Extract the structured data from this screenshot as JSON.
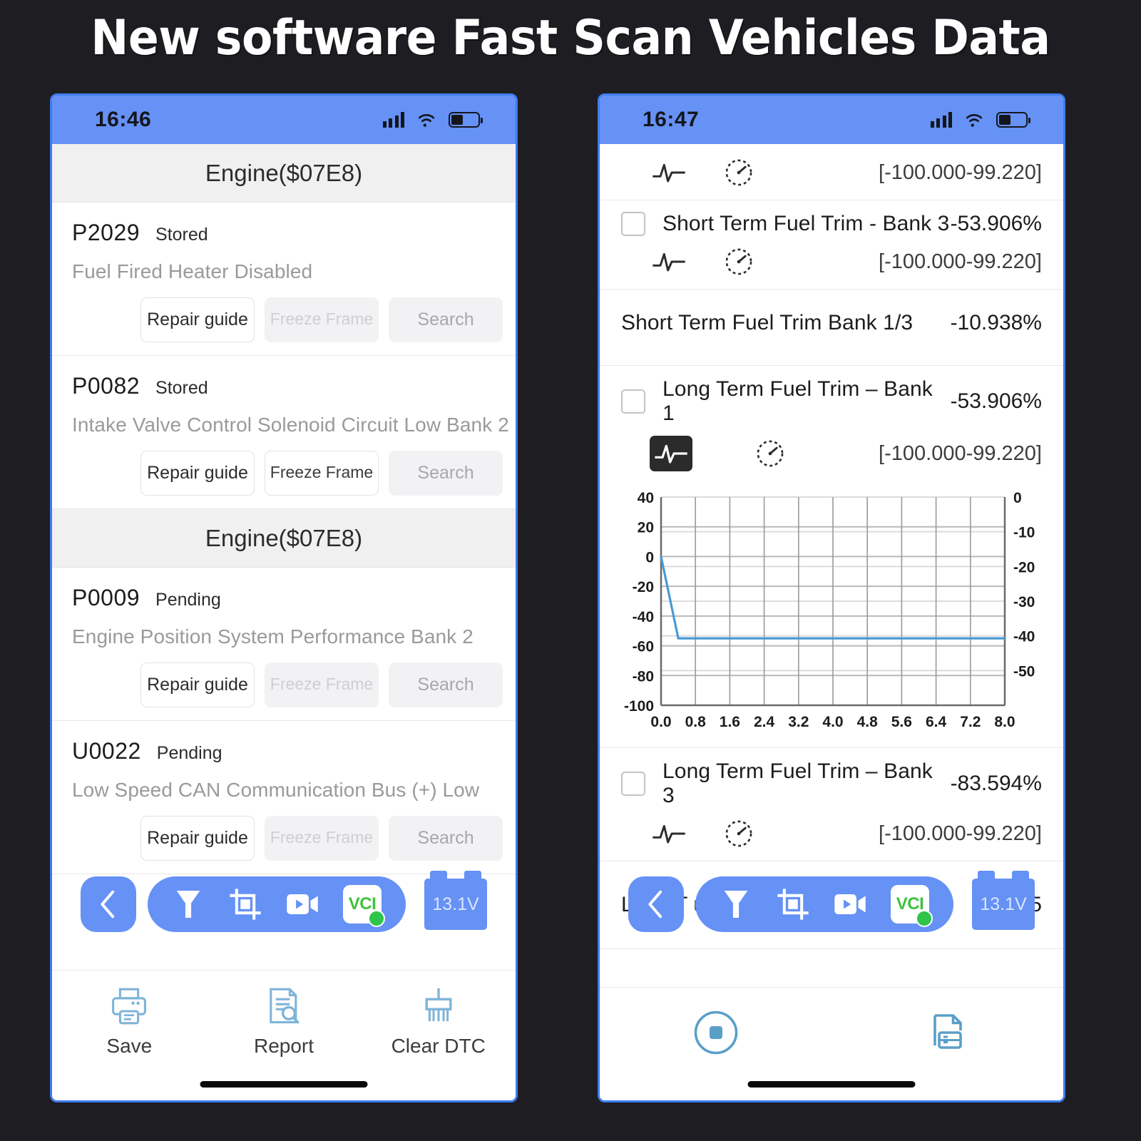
{
  "banner": {
    "title": "New software Fast Scan Vehicles Data"
  },
  "left_phone": {
    "status": {
      "time": "16:46",
      "signal_icon": "cellular-signal-icon",
      "wifi_icon": "wifi-icon",
      "battery_icon": "battery-icon"
    },
    "groups": [
      {
        "header": "Engine($07E8)",
        "codes": [
          {
            "code": "P2029",
            "state": "Stored",
            "description": "Fuel Fired Heater Disabled",
            "repair_label": "Repair guide",
            "freeze_label": "Freeze Frame",
            "freeze_enabled": false,
            "search_label": "Search"
          },
          {
            "code": "P0082",
            "state": "Stored",
            "description": "Intake Valve Control Solenoid Circuit Low Bank 2",
            "repair_label": "Repair guide",
            "freeze_label": "Freeze Frame",
            "freeze_enabled": true,
            "search_label": "Search"
          }
        ]
      },
      {
        "header": "Engine($07E8)",
        "codes": [
          {
            "code": "P0009",
            "state": "Pending",
            "description": "Engine Position System Performance Bank 2",
            "repair_label": "Repair guide",
            "freeze_label": "Freeze Frame",
            "freeze_enabled": false,
            "search_label": "Search"
          },
          {
            "code": "U0022",
            "state": "Pending",
            "description": "Low Speed CAN Communication Bus (+) Low",
            "repair_label": "Repair guide",
            "freeze_label": "Freeze Frame",
            "freeze_enabled": false,
            "search_label": "Search"
          }
        ]
      }
    ],
    "toolbar": {
      "back_icon": "chevron-left-icon",
      "items": [
        {
          "icon": "flashlight-icon"
        },
        {
          "icon": "screenshot-crop-icon"
        },
        {
          "icon": "video-record-icon"
        },
        {
          "icon": "vci-connection-icon",
          "label": "VCI"
        }
      ],
      "voltage": "13.1V"
    },
    "bottom_nav": [
      {
        "icon": "printer-icon",
        "label": "Save"
      },
      {
        "icon": "report-search-icon",
        "label": "Report"
      },
      {
        "icon": "brush-clear-icon",
        "label": "Clear DTC"
      }
    ]
  },
  "right_phone": {
    "status": {
      "time": "16:47",
      "signal_icon": "cellular-signal-icon",
      "wifi_icon": "wifi-icon",
      "battery_icon": "battery-icon"
    },
    "rows": [
      {
        "type": "icons_only",
        "graph_icon": "waveform-icon",
        "gauge_icon": "gauge-icon",
        "range": "[-100.000-99.220]"
      },
      {
        "type": "param",
        "name": "Short Term Fuel Trim - Bank 3",
        "value": "-53.906%",
        "graph_icon": "waveform-icon",
        "gauge_icon": "gauge-icon",
        "graph_active": false,
        "range": "[-100.000-99.220]"
      },
      {
        "type": "plain",
        "name": "Short Term Fuel Trim Bank 1/3",
        "value": "-10.938%"
      },
      {
        "type": "param",
        "name": "Long Term Fuel Trim – Bank 1",
        "value": "-53.906%",
        "graph_icon": "waveform-icon",
        "gauge_icon": "gauge-icon",
        "graph_active": true,
        "range": "[-100.000-99.220]"
      },
      {
        "type": "param",
        "name": "Long Term Fuel Trim – Bank 3",
        "value": "-83.594%",
        "graph_icon": "waveform-icon",
        "gauge_icon": "gauge-icon",
        "graph_active": false,
        "range": "[-100.000-99.220]"
      },
      {
        "type": "obscured",
        "name": "Long T         uel",
        "value": "-5"
      }
    ],
    "toolbar": {
      "back_icon": "chevron-left-icon",
      "items": [
        {
          "icon": "flashlight-icon"
        },
        {
          "icon": "screenshot-crop-icon"
        },
        {
          "icon": "video-record-icon"
        },
        {
          "icon": "vci-connection-icon",
          "label": "VCI"
        }
      ],
      "voltage": "13.1V"
    },
    "bottom_actions": [
      {
        "icon": "stop-record-icon"
      },
      {
        "icon": "save-report-icon"
      }
    ]
  },
  "chart_data": {
    "type": "line",
    "title": "",
    "xlabel": "",
    "ylabel": "",
    "x": [
      0.0,
      0.4,
      0.8,
      1.6,
      2.4,
      3.2,
      4.0,
      4.8,
      5.6,
      6.4,
      7.2,
      8.0
    ],
    "series": [
      {
        "name": "Long Term Fuel Trim – Bank 1",
        "color": "#4a9ad4",
        "values": [
          0,
          -55,
          -55,
          -55,
          -55,
          -55,
          -55,
          -55,
          -55,
          -55,
          -55,
          -55
        ]
      }
    ],
    "xticks": [
      "0.0",
      "0.8",
      "1.6",
      "2.4",
      "3.2",
      "4.0",
      "4.8",
      "5.6",
      "6.4",
      "7.2",
      "8.0"
    ],
    "xlim": [
      0,
      8.0
    ],
    "left_axis": {
      "ticks": [
        "40",
        "20",
        "0",
        "-20",
        "-40",
        "-60",
        "-80",
        "-100"
      ],
      "lim": [
        -100,
        40
      ]
    },
    "right_axis": {
      "ticks": [
        "0",
        "-10",
        "-20",
        "-30",
        "-40",
        "-50"
      ],
      "lim": [
        -60,
        0
      ]
    },
    "grid": true,
    "legend": "none"
  }
}
